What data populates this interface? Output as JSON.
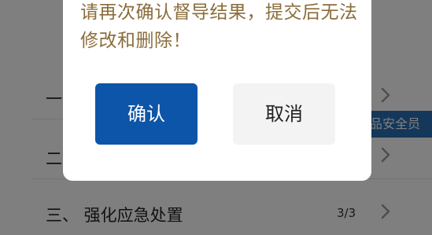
{
  "list": {
    "rows": [
      {
        "label": "一",
        "count": ""
      },
      {
        "label": "二",
        "count": ""
      },
      {
        "label": "三、  强化应急处置",
        "count": "3/3"
      }
    ],
    "side_tag": "品安全员"
  },
  "dialog": {
    "message": "请再次确认督导结果，提交后无法修改和删除！",
    "confirm_label": "确认",
    "cancel_label": "取消"
  },
  "colors": {
    "confirm_bg": "#0d55a8",
    "message_text": "#8a6d3b",
    "side_tag_bg": "#2a6fb5"
  },
  "icons": {
    "row_chevron": "chevron-right-icon"
  }
}
